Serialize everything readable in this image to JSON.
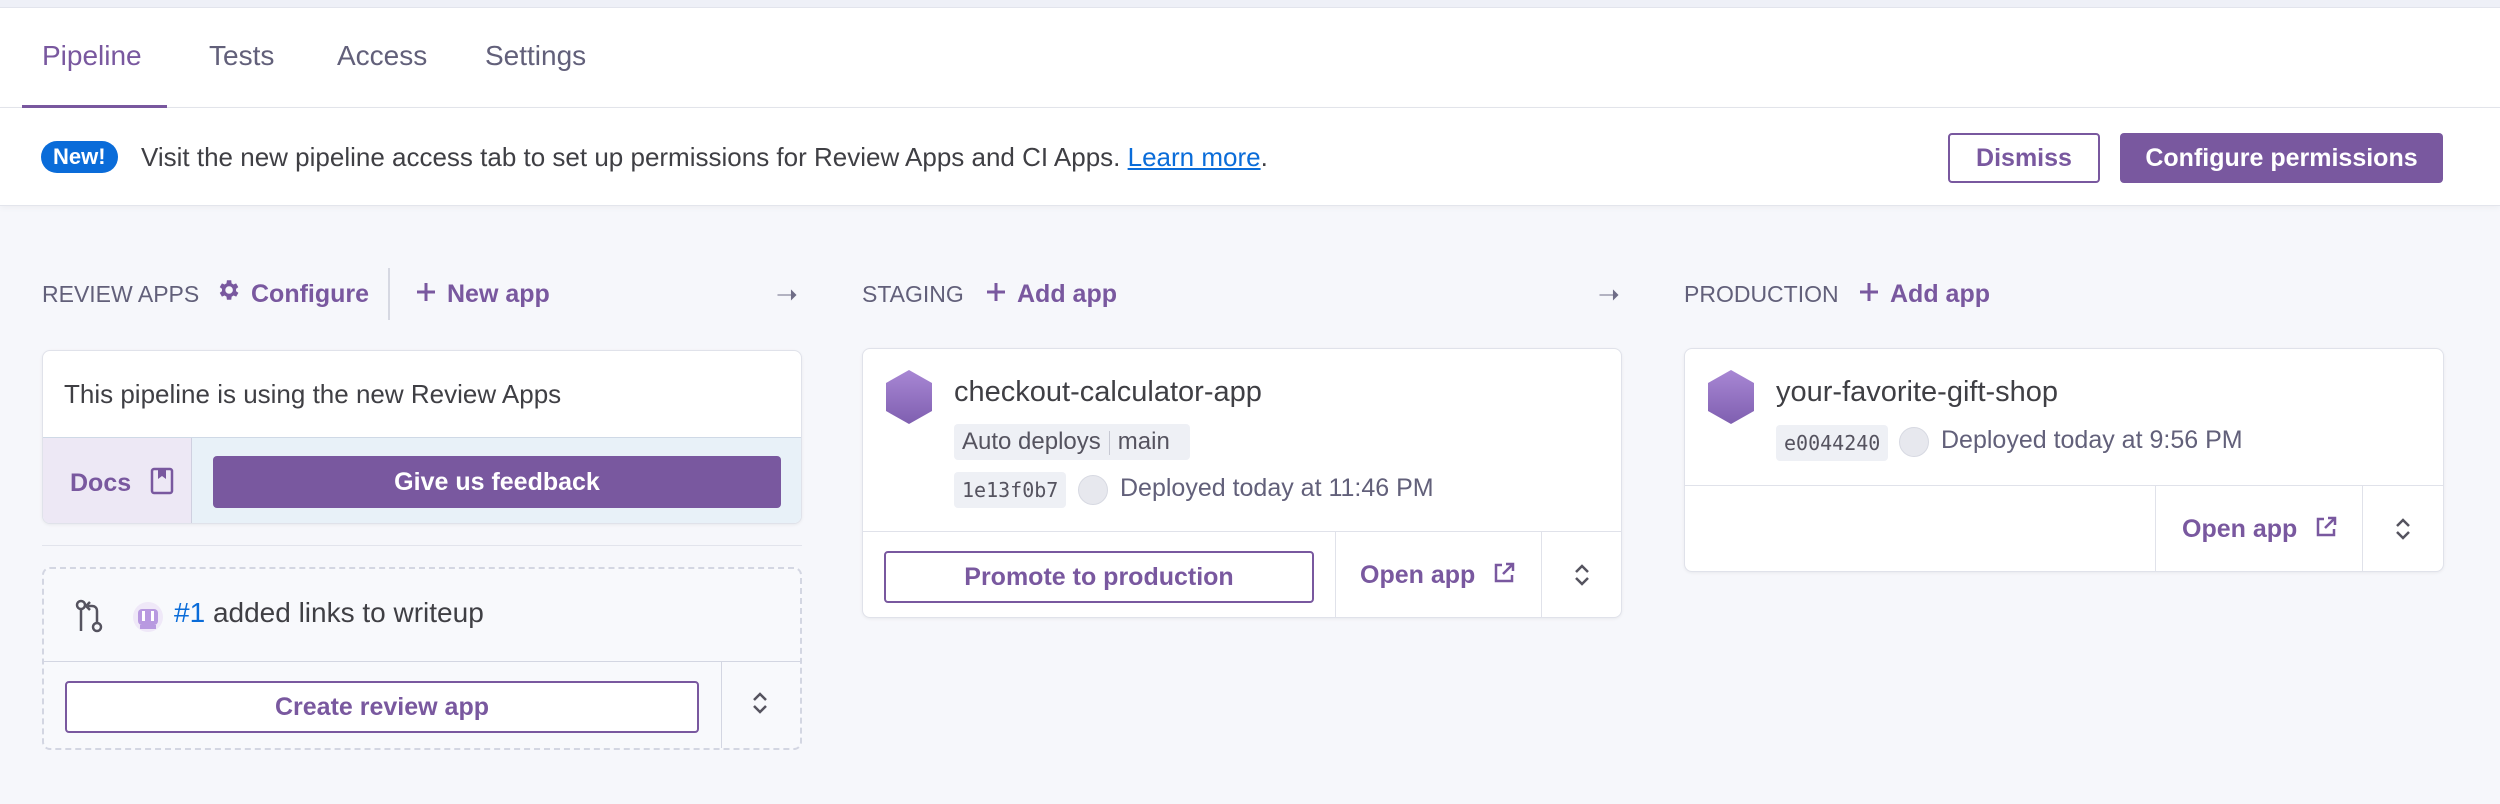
{
  "tabs": [
    {
      "label": "Pipeline",
      "active": true
    },
    {
      "label": "Tests"
    },
    {
      "label": "Access"
    },
    {
      "label": "Settings"
    }
  ],
  "banner": {
    "badge": "New!",
    "text": "Visit the new pipeline access tab to set up permissions for Review Apps and CI Apps. ",
    "link": "Learn more",
    "link_suffix": ".",
    "dismiss": "Dismiss",
    "configure": "Configure permissions"
  },
  "review_apps": {
    "title": "REVIEW APPS",
    "configure": "Configure",
    "new_app": "New app",
    "info_text": "This pipeline is using the new Review Apps",
    "docs": "Docs",
    "feedback": "Give us feedback",
    "pr_number": "#1",
    "pr_title": "added links to writeup",
    "create": "Create review app"
  },
  "staging": {
    "title": "STAGING",
    "add_app": "Add app",
    "app_name": "checkout-calculator-app",
    "auto_deploys": "Auto deploys",
    "branch": "main",
    "commit": "1e13f0b7",
    "deployed": "Deployed today at 11:46 PM",
    "promote": "Promote to production",
    "open_app": "Open app"
  },
  "production": {
    "title": "PRODUCTION",
    "add_app": "Add app",
    "app_name": "your-favorite-gift-shop",
    "commit": "e0044240",
    "deployed": "Deployed today at 9:56 PM",
    "open_app": "Open app"
  },
  "colors": {
    "accent": "#79589f",
    "link": "#0a6cd9",
    "hex_top": "#a887d4",
    "hex_bottom": "#7f5fb0"
  },
  "icons": [
    "gear-icon",
    "plus-icon",
    "arrow-right-icon",
    "book-icon",
    "pull-request-icon",
    "github-avatar-icon",
    "external-link-icon",
    "chevron-updown-icon",
    "app-hexagon-icon",
    "user-avatar-icon"
  ]
}
